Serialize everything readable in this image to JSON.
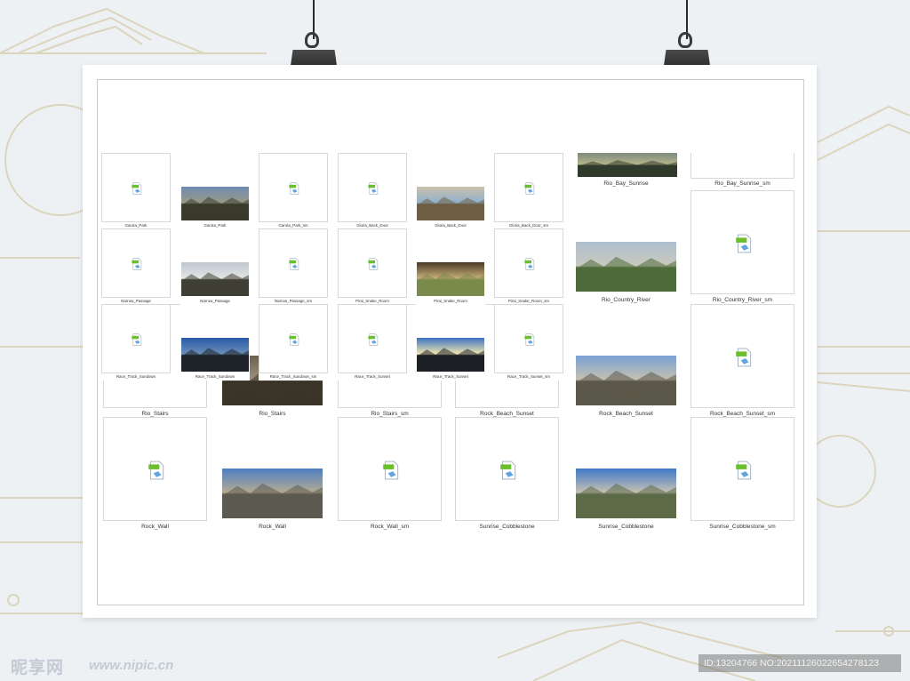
{
  "watermark": {
    "logo": "昵享网",
    "url": "www.nipic.cn",
    "id_text": "ID:13204766 NO:20211126022654278123"
  },
  "back_grid": [
    {
      "label": "Rio_Bay_Sunrise",
      "type": "photo",
      "scene": "bay"
    },
    {
      "label": "Rio_Bay_Sunrise_sm",
      "type": "file"
    },
    {
      "label": "Rio_Country_River",
      "type": "photo",
      "scene": "river"
    },
    {
      "label": "Rio_Country_River_sm",
      "type": "file"
    },
    {
      "label": "Rio_Stairs",
      "type": "file"
    },
    {
      "label": "Rio_Stairs",
      "type": "photo",
      "scene": "stairs"
    },
    {
      "label": "Rio_Stairs_sm",
      "type": "file"
    },
    {
      "label": "Rock_Beach_Sunset",
      "type": "file"
    },
    {
      "label": "Rock_Beach_Sunset",
      "type": "photo",
      "scene": "beach"
    },
    {
      "label": "Rock_Beach_Sunset_sm",
      "type": "file"
    },
    {
      "label": "Rock_Wall",
      "type": "file"
    },
    {
      "label": "Rock_Wall",
      "type": "photo",
      "scene": "rockwall"
    },
    {
      "label": "Rock_Wall_sm",
      "type": "file"
    },
    {
      "label": "Sunrise_Cobblestone",
      "type": "file"
    },
    {
      "label": "Sunrise_Cobblestone",
      "type": "photo",
      "scene": "cobble"
    },
    {
      "label": "Sunrise_Cobblestone_sm",
      "type": "file"
    }
  ],
  "front_grid": [
    {
      "label": "Garota_Park",
      "type": "file"
    },
    {
      "label": "Garota_Park",
      "type": "photo",
      "scene": "park"
    },
    {
      "label": "Garota_Park_sm",
      "type": "file"
    },
    {
      "label": "Gloria_Back_Door",
      "type": "file"
    },
    {
      "label": "Gloria_Back_Door",
      "type": "photo",
      "scene": "door"
    },
    {
      "label": "Gloria_Back_Door_sm",
      "type": "file"
    },
    {
      "label": "Narrow_Passage",
      "type": "file"
    },
    {
      "label": "Narrow_Passage",
      "type": "photo",
      "scene": "passage"
    },
    {
      "label": "Narrow_Passage_sm",
      "type": "file"
    },
    {
      "label": "Pirai_Snake_Room",
      "type": "file"
    },
    {
      "label": "Pirai_Snake_Room",
      "type": "photo",
      "scene": "snake"
    },
    {
      "label": "Pirai_Snake_Room_sm",
      "type": "file"
    },
    {
      "label": "Race_Track_Sundown",
      "type": "file"
    },
    {
      "label": "Race_Track_Sundown",
      "type": "photo",
      "scene": "sundown"
    },
    {
      "label": "Race_Track_Sundown_sm",
      "type": "file"
    },
    {
      "label": "Race_Track_Sunset",
      "type": "file"
    },
    {
      "label": "Race_Track_Sunset",
      "type": "photo",
      "scene": "sunset"
    },
    {
      "label": "Race_Track_Sunset_sm",
      "type": "file"
    }
  ],
  "colors": {
    "board": "#ffffff",
    "background": "#eef1f4",
    "deco_line": "#d9d2b8",
    "file_icon_green": "#6bbf2f",
    "file_icon_blue": "#3a8fd8"
  }
}
